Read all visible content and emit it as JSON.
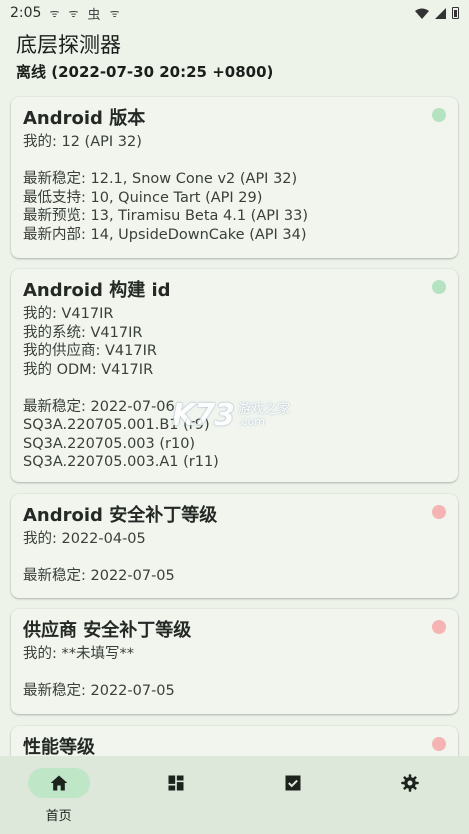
{
  "status_bar": {
    "time": "2:05",
    "icons": [
      "sync-icon",
      "sync-icon",
      "bug-icon",
      "sync-icon",
      "wifi-icon",
      "signal-icon",
      "battery-icon"
    ],
    "icon_glyphs": [
      "ᯤ",
      "ᯤ",
      "虫",
      "ᯤ"
    ]
  },
  "app_bar": {
    "title": "底层探测器",
    "subtitle": "离线 (2022-07-30 20:25 +0800)"
  },
  "cards": [
    {
      "title": "Android 版本",
      "status": "green",
      "lines": [
        "我的: 12 (API 32)",
        "",
        "最新稳定: 12.1, Snow Cone v2 (API 32)",
        "最低支持: 10, Quince Tart (API 29)",
        "最新预览: 13, Tiramisu Beta 4.1 (API 33)",
        "最新内部: 14, UpsideDownCake (API 34)"
      ]
    },
    {
      "title": "Android 构建 id",
      "status": "green",
      "lines": [
        "我的: V417IR",
        "我的系统: V417IR",
        "我的供应商: V417IR",
        "我的 ODM: V417IR",
        "",
        "最新稳定: 2022-07-06",
        "SQ3A.220705.001.B1 (r9)",
        "SQ3A.220705.003 (r10)",
        "SQ3A.220705.003.A1 (r11)"
      ]
    },
    {
      "title": "Android 安全补丁等级",
      "status": "red",
      "lines": [
        "我的: 2022-04-05",
        "",
        "最新稳定: 2022-07-05"
      ]
    },
    {
      "title": "供应商 安全补丁等级",
      "status": "red",
      "lines": [
        "我的: **未填写**",
        "",
        "最新稳定: 2022-07-05"
      ]
    },
    {
      "title": "性能等级",
      "status": "red",
      "lines": []
    }
  ],
  "watermark": {
    "logo": "K73",
    "cn": "游戏之家",
    "en": ".com"
  },
  "bottom_nav": [
    {
      "label": "首页",
      "icon": "home-icon",
      "active": true
    },
    {
      "label": "",
      "icon": "dashboard-icon",
      "active": false
    },
    {
      "label": "",
      "icon": "checkbox-icon",
      "active": false
    },
    {
      "label": "",
      "icon": "settings-icon",
      "active": false
    }
  ],
  "colors": {
    "status_green": "#b5e3c2",
    "status_red": "#f5b3b3",
    "nav_active_pill": "#bfe7c7",
    "nav_background": "#dde7da",
    "card_background": "#f1f5ee"
  }
}
